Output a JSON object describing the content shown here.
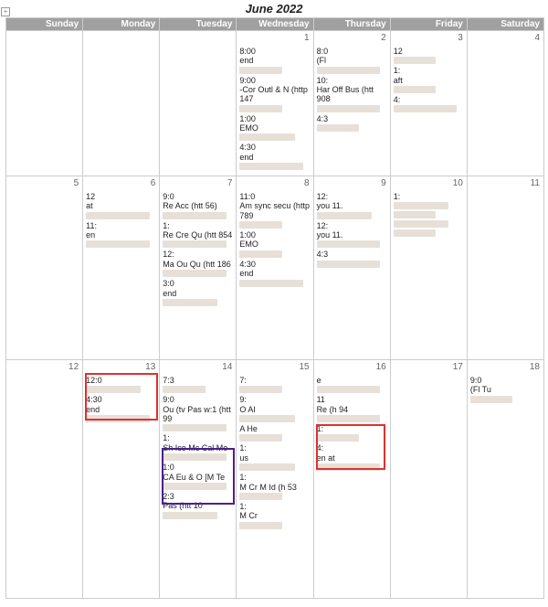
{
  "title": "June 2022",
  "daynames": [
    "Sunday",
    "Monday",
    "Tuesday",
    "Wednesday",
    "Thursday",
    "Friday",
    "Saturday"
  ],
  "weeks": [
    {
      "days": [
        {
          "n": "",
          "ev": []
        },
        {
          "n": "",
          "ev": []
        },
        {
          "n": "",
          "ev": []
        },
        {
          "n": "1",
          "ev": [
            {
              "t": "8:00",
              "s": "end"
            },
            {
              "t": "9:00",
              "s": "-Cor Outl & N (http 147"
            },
            {
              "t": "1:00",
              "s": "EMO"
            },
            {
              "t": "4:30",
              "s": "end"
            }
          ]
        },
        {
          "n": "2",
          "ev": [
            {
              "t": "8:0",
              "s": "(Fl"
            },
            {
              "t": "10:",
              "s": "Har Off Bus (htt 908"
            },
            {
              "t": "4:3",
              "s": ""
            }
          ]
        },
        {
          "n": "3",
          "ev": [
            {
              "t": "12",
              "s": ""
            },
            {
              "t": "1:",
              "s": "aft"
            },
            {
              "t": "4:",
              "s": ""
            }
          ]
        },
        {
          "n": "4",
          "ev": []
        }
      ]
    },
    {
      "days": [
        {
          "n": "5",
          "ev": []
        },
        {
          "n": "6",
          "ev": [
            {
              "t": "12",
              "s": "at"
            },
            {
              "t": "11:",
              "s": "en"
            }
          ]
        },
        {
          "n": "7",
          "ev": [
            {
              "t": "9:0",
              "s": "Re Acc (htt 56)"
            },
            {
              "t": "1:",
              "s": "Re Cre Qu (htt 854"
            },
            {
              "t": "12:",
              "s": "Ma Ou Qu (htt 186"
            },
            {
              "t": "3:0",
              "s": "end"
            }
          ]
        },
        {
          "n": "8",
          "ev": [
            {
              "t": "11:0",
              "s": "Am sync secu (http 789"
            },
            {
              "t": "1:00",
              "s": "EMO"
            },
            {
              "t": "4:30",
              "s": "end"
            }
          ]
        },
        {
          "n": "9",
          "ev": [
            {
              "t": "12:",
              "s": "you 11."
            },
            {
              "t": "12:",
              "s": "you 11."
            },
            {
              "t": "4:3",
              "s": ""
            }
          ]
        },
        {
          "n": "10",
          "ev": [
            {
              "t": "1:",
              "s": ""
            },
            {
              "t": "",
              "s": ""
            },
            {
              "t": "",
              "s": ""
            },
            {
              "t": "",
              "s": ""
            }
          ]
        },
        {
          "n": "11",
          "ev": []
        }
      ]
    },
    {
      "days": [
        {
          "n": "12",
          "ev": []
        },
        {
          "n": "13",
          "ev": [
            {
              "t": "12:0",
              "s": ""
            },
            {
              "t": "4:30",
              "s": "end"
            }
          ]
        },
        {
          "n": "14",
          "ev": [
            {
              "t": "7:3",
              "s": ""
            },
            {
              "t": "9:0",
              "s": "Ou (tv Pas w:1 (htt 99"
            },
            {
              "t": "1:",
              "s": "Sh Ico Mc Cal Me"
            },
            {
              "t": "1:0",
              "s": "CA Eu & O [M Te"
            },
            {
              "t": "2:3",
              "s": "Pas (htt 10"
            }
          ]
        },
        {
          "n": "15",
          "ev": [
            {
              "t": "7:",
              "s": ""
            },
            {
              "t": "9:",
              "s": "O AI"
            },
            {
              "t": "",
              "s": "A He"
            },
            {
              "t": "1:",
              "s": "us"
            },
            {
              "t": "1:",
              "s": "M Cr M Id (h 53"
            },
            {
              "t": "1:",
              "s": "M Cr"
            }
          ]
        },
        {
          "n": "16",
          "ev": [
            {
              "t": "",
              "s": "e"
            },
            {
              "t": "11",
              "s": "Re (h 94"
            },
            {
              "t": "1:",
              "s": ""
            },
            {
              "t": "4:",
              "s": "en at"
            }
          ]
        },
        {
          "n": "17",
          "ev": []
        },
        {
          "n": "18",
          "ev": [
            {
              "t": "9:0",
              "s": "(Fl Tu"
            }
          ]
        }
      ]
    }
  ],
  "expand_glyph": "+"
}
